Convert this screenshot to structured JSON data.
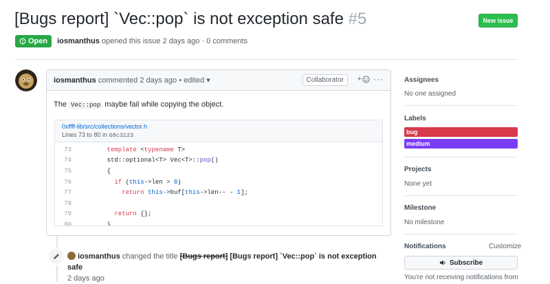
{
  "issue": {
    "title": "[Bugs report] `Vec::pop` is not exception safe",
    "number": "#5",
    "state": "Open",
    "author": "iosmanthus",
    "meta_rest": "opened this issue 2 days ago · 0 comments"
  },
  "header": {
    "new_issue_label": "New issue"
  },
  "comment": {
    "author": "iosmanthus",
    "when": "commented 2 days ago",
    "edited": "• edited",
    "role": "Collaborator",
    "reaction_label": "+",
    "more_label": "···",
    "body_before": "The ",
    "body_code": "Vec::pop",
    "body_after": " maybe fail while copying the object.",
    "snippet": {
      "path": "0xffff-lib/src/collections/vector.h",
      "lines_text": "Lines 73 to 80 in ",
      "commit": "68c3123"
    }
  },
  "event": {
    "actor": "iosmanthus",
    "action": "changed the title",
    "old_title": "[Bugs report]",
    "new_title": "[Bugs report] `Vec::pop` is not exception safe",
    "when": "2 days ago"
  },
  "sidebar": {
    "assignees_heading": "Assignees",
    "assignees_value": "No one assigned",
    "labels_heading": "Labels",
    "labels": [
      {
        "name": "bug",
        "color": "#d73a4a"
      },
      {
        "name": "medium",
        "color": "#7a3ef5"
      }
    ],
    "projects_heading": "Projects",
    "projects_value": "None yet",
    "milestone_heading": "Milestone",
    "milestone_value": "No milestone",
    "notifications_heading": "Notifications",
    "customize_label": "Customize",
    "subscribe_label": "Subscribe",
    "notif_note": "You're not receiving notifications from"
  },
  "icons": {
    "open_state": "issue-opened-icon",
    "edit_event": "pencil-icon",
    "subscribe": "speaker-icon",
    "reaction": "smiley-icon"
  }
}
